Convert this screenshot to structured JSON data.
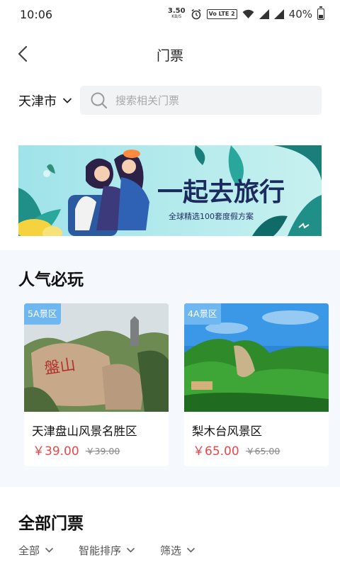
{
  "status_bar": {
    "time": "10:06",
    "net_speed_value": "3.50",
    "net_speed_unit": "KB/S",
    "volte": "Vo LTE 2",
    "battery": "40%",
    "battery_level": 0.4
  },
  "header": {
    "title": "门票"
  },
  "search": {
    "city": "天津市",
    "placeholder": "搜索相关门票"
  },
  "banner": {
    "headline": "一起去旅行",
    "subline": "全球精选100套度假方案"
  },
  "popular": {
    "title": "人气必玩",
    "items": [
      {
        "badge": "5A景区",
        "name": "天津盘山风景名胜区",
        "price": "￥39.00",
        "original_price": "￥39.00",
        "rock_text": "盤山"
      },
      {
        "badge": "4A景区",
        "name": "梨木台风景区",
        "price": "￥65.00",
        "original_price": "￥65.00"
      }
    ]
  },
  "all_tickets": {
    "title": "全部门票",
    "filters": [
      {
        "label": "全部"
      },
      {
        "label": "智能排序"
      },
      {
        "label": "筛选"
      }
    ]
  },
  "colors": {
    "price": "#e8484a",
    "badge": "#6fb7f0",
    "section_bg": "#f5f8fc",
    "search_bg": "#f2f3f5"
  }
}
